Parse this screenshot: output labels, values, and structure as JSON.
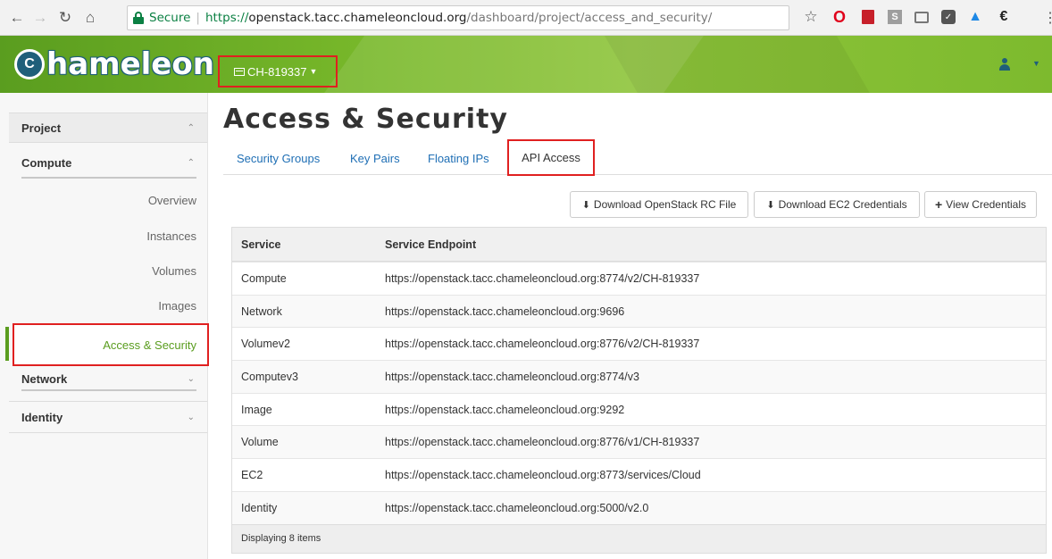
{
  "browser": {
    "secure_label": "Secure",
    "url_scheme": "https://",
    "url_host": "openstack.tacc.chameleoncloud.org",
    "url_path": "/dashboard/project/access_and_security/"
  },
  "header": {
    "logo_initial": "C",
    "logo_text": "hameleon",
    "project_name": "CH-819337"
  },
  "sidebar": {
    "project": "Project",
    "compute": "Compute",
    "items": [
      "Overview",
      "Instances",
      "Volumes",
      "Images",
      "Access & Security"
    ],
    "network": "Network",
    "identity": "Identity"
  },
  "main": {
    "title": "Access & Security",
    "tabs": [
      "Security Groups",
      "Key Pairs",
      "Floating IPs",
      "API Access"
    ],
    "buttons": {
      "download_rc": "Download OpenStack RC File",
      "download_ec2": "Download EC2 Credentials",
      "view_credentials": "View Credentials"
    },
    "table": {
      "headers": [
        "Service",
        "Service Endpoint"
      ],
      "rows": [
        [
          "Compute",
          "https://openstack.tacc.chameleoncloud.org:8774/v2/CH-819337"
        ],
        [
          "Network",
          "https://openstack.tacc.chameleoncloud.org:9696"
        ],
        [
          "Volumev2",
          "https://openstack.tacc.chameleoncloud.org:8776/v2/CH-819337"
        ],
        [
          "Computev3",
          "https://openstack.tacc.chameleoncloud.org:8774/v3"
        ],
        [
          "Image",
          "https://openstack.tacc.chameleoncloud.org:9292"
        ],
        [
          "Volume",
          "https://openstack.tacc.chameleoncloud.org:8776/v1/CH-819337"
        ],
        [
          "EC2",
          "https://openstack.tacc.chameleoncloud.org:8773/services/Cloud"
        ],
        [
          "Identity",
          "https://openstack.tacc.chameleoncloud.org:5000/v2.0"
        ]
      ],
      "footer": "Displaying 8 items"
    }
  },
  "colors": {
    "brand_green": "#5a9d1f",
    "link_blue": "#1f6fb5",
    "highlight_red": "#e02020"
  }
}
